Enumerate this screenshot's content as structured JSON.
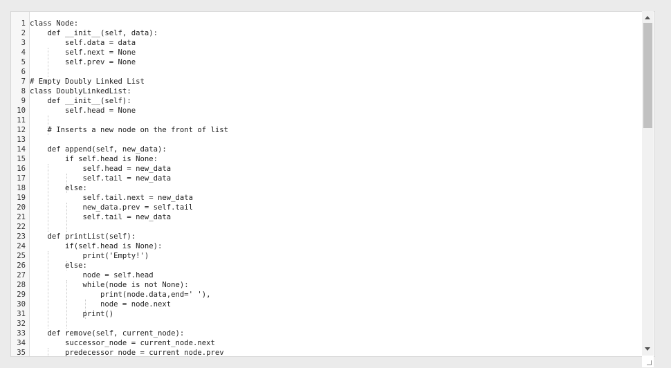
{
  "editor": {
    "lines": [
      {
        "n": "1",
        "text": "class Node:"
      },
      {
        "n": "2",
        "text": "    def __init__(self, data):"
      },
      {
        "n": "3",
        "text": "        self.data = data"
      },
      {
        "n": "4",
        "text": "        self.next = None"
      },
      {
        "n": "5",
        "text": "        self.prev = None"
      },
      {
        "n": "6",
        "text": ""
      },
      {
        "n": "7",
        "text": "# Empty Doubly Linked List"
      },
      {
        "n": "8",
        "text": "class DoublyLinkedList:"
      },
      {
        "n": "9",
        "text": "    def __init__(self):"
      },
      {
        "n": "10",
        "text": "        self.head = None"
      },
      {
        "n": "11",
        "text": ""
      },
      {
        "n": "12",
        "text": "    # Inserts a new node on the front of list"
      },
      {
        "n": "13",
        "text": ""
      },
      {
        "n": "14",
        "text": "    def append(self, new_data):"
      },
      {
        "n": "15",
        "text": "        if self.head is None:"
      },
      {
        "n": "16",
        "text": "            self.head = new_data"
      },
      {
        "n": "17",
        "text": "            self.tail = new_data"
      },
      {
        "n": "18",
        "text": "        else:"
      },
      {
        "n": "19",
        "text": "            self.tail.next = new_data"
      },
      {
        "n": "20",
        "text": "            new_data.prev = self.tail"
      },
      {
        "n": "21",
        "text": "            self.tail = new_data"
      },
      {
        "n": "22",
        "text": ""
      },
      {
        "n": "23",
        "text": "    def printList(self):"
      },
      {
        "n": "24",
        "text": "        if(self.head is None):"
      },
      {
        "n": "25",
        "text": "            print('Empty!')"
      },
      {
        "n": "26",
        "text": "        else:"
      },
      {
        "n": "27",
        "text": "            node = self.head"
      },
      {
        "n": "28",
        "text": "            while(node is not None):"
      },
      {
        "n": "29",
        "text": "                print(node.data,end=' '),"
      },
      {
        "n": "30",
        "text": "                node = node.next"
      },
      {
        "n": "31",
        "text": "            print()"
      },
      {
        "n": "32",
        "text": ""
      },
      {
        "n": "33",
        "text": "    def remove(self, current_node):"
      },
      {
        "n": "34",
        "text": "        successor_node = current_node.next"
      },
      {
        "n": "35",
        "text": "        predecessor_node = current_node.prev"
      }
    ]
  },
  "icons": {
    "scroll_up": "arrow-up-icon",
    "scroll_down": "arrow-down-icon",
    "resize": "resize-grip-icon"
  }
}
